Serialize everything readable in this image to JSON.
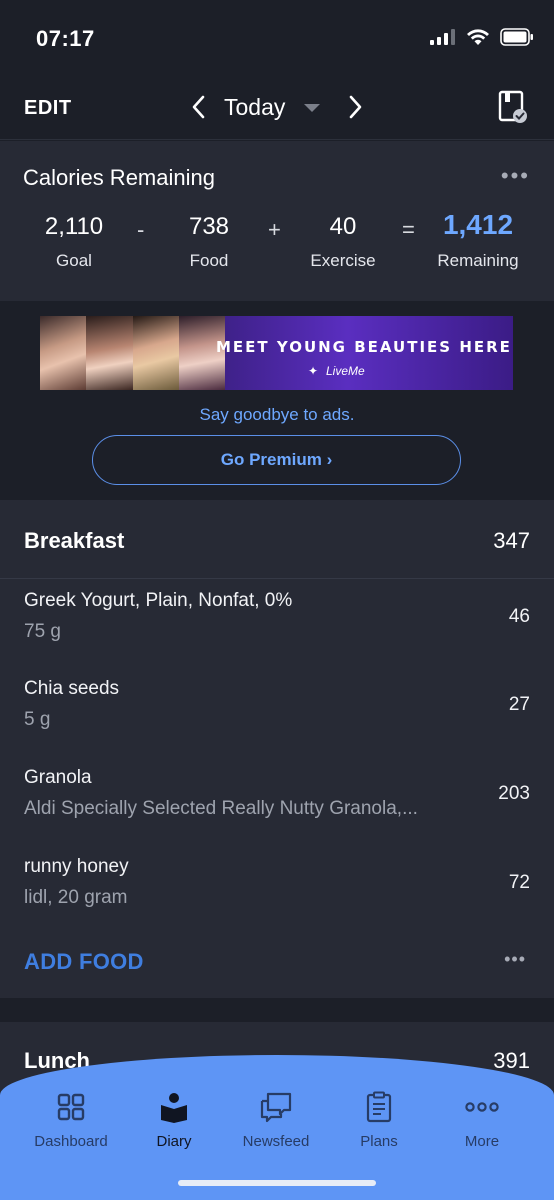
{
  "status": {
    "time": "07:17"
  },
  "nav": {
    "edit": "EDIT",
    "date": "Today"
  },
  "calories": {
    "title": "Calories Remaining",
    "more": "•••",
    "goal_value": "2,110",
    "goal_label": "Goal",
    "minus": "-",
    "food_value": "738",
    "food_label": "Food",
    "plus": "+",
    "exercise_value": "40",
    "exercise_label": "Exercise",
    "equals": "=",
    "remaining_value": "1,412",
    "remaining_label": "Remaining"
  },
  "ad": {
    "banner_text": "MEET YOUNG BEAUTIES HERE",
    "banner_brand": "LiveMe",
    "goodbye": "Say goodbye to ads.",
    "premium": "Go Premium ›"
  },
  "breakfast": {
    "title": "Breakfast",
    "calories": "347",
    "items": [
      {
        "name": "Greek Yogurt, Plain, Nonfat, 0%",
        "desc": "75 g",
        "cal": "46"
      },
      {
        "name": "Chia seeds",
        "desc": "5 g",
        "cal": "27"
      },
      {
        "name": "Granola",
        "desc": "Aldi Specially Selected Really Nutty Granola,...",
        "cal": "203"
      },
      {
        "name": "runny honey",
        "desc": "lidl, 20 gram",
        "cal": "72"
      }
    ],
    "add_food": "ADD FOOD",
    "more": "•••"
  },
  "lunch": {
    "title": "Lunch",
    "calories": "391"
  },
  "tabs": [
    {
      "label": "Dashboard",
      "icon": "dashboard-icon"
    },
    {
      "label": "Diary",
      "icon": "diary-icon"
    },
    {
      "label": "Newsfeed",
      "icon": "newsfeed-icon"
    },
    {
      "label": "Plans",
      "icon": "plans-icon"
    },
    {
      "label": "More",
      "icon": "more-icon"
    }
  ],
  "colors": {
    "accent": "#6ea8ff",
    "tab_bar": "#5e95f5",
    "card": "#272a35",
    "background": "#1c1f28"
  }
}
